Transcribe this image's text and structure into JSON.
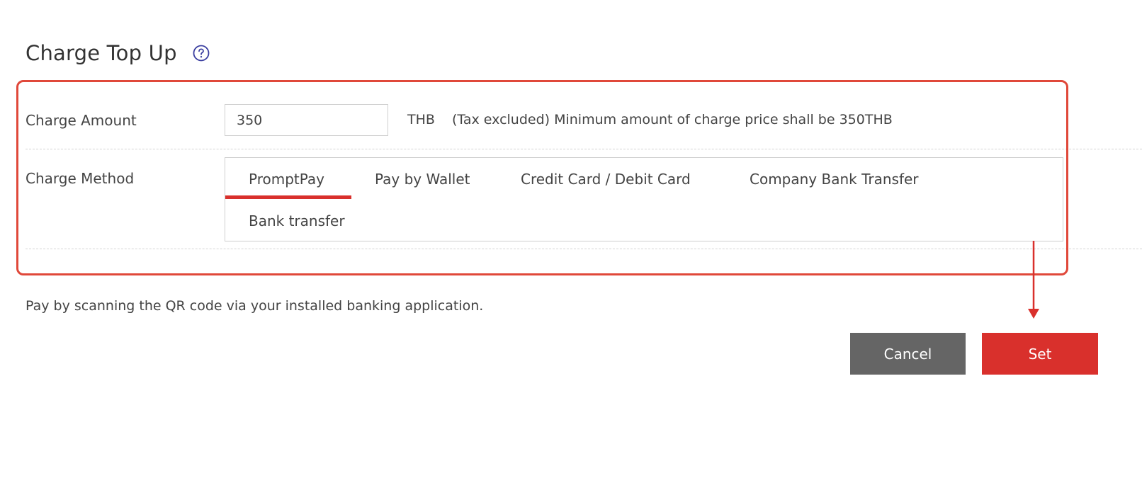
{
  "header": {
    "title": "Charge Top Up",
    "help_icon": "question-circle-icon"
  },
  "charge_amount": {
    "label": "Charge Amount",
    "value": "350",
    "unit": "THB",
    "note": "(Tax excluded) Minimum amount of charge price shall be 350THB"
  },
  "charge_method": {
    "label": "Charge Method",
    "tabs": [
      {
        "label": "PromptPay",
        "selected": true
      },
      {
        "label": "Pay by Wallet",
        "selected": false
      },
      {
        "label": "Credit Card / Debit Card",
        "selected": false
      },
      {
        "label": "Company Bank Transfer",
        "selected": false
      },
      {
        "label": "Bank transfer",
        "selected": false
      }
    ]
  },
  "description": "Pay by scanning the QR code via your installed banking application.",
  "actions": {
    "cancel_label": "Cancel",
    "set_label": "Set"
  },
  "colors": {
    "accent": "#d9302c",
    "annotation": "#e0483a",
    "cancel_bg": "#656565",
    "help_icon": "#3b3fa0"
  }
}
